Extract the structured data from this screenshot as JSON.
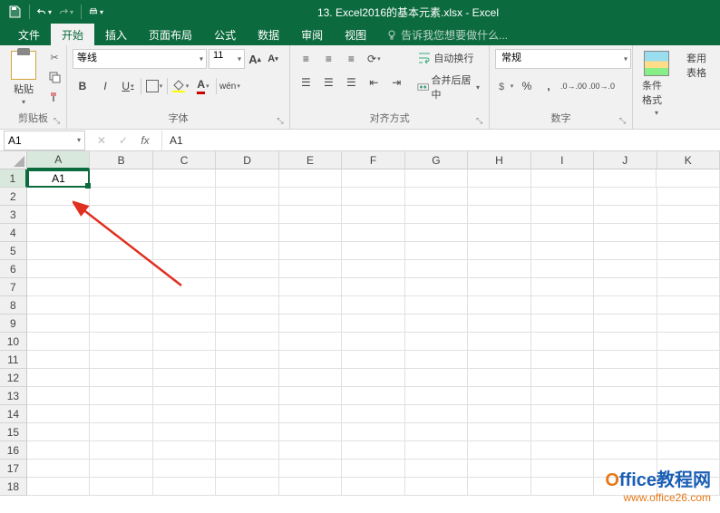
{
  "title": "13. Excel2016的基本元素.xlsx - Excel",
  "menus": [
    "文件",
    "开始",
    "插入",
    "页面布局",
    "公式",
    "数据",
    "审阅",
    "视图"
  ],
  "active_menu": 1,
  "tellme": "告诉我您想要做什么...",
  "ribbon": {
    "clipboard": {
      "label": "剪贴板",
      "paste": "粘贴"
    },
    "font": {
      "label": "字体",
      "name": "等线",
      "size": "11",
      "bold": "B",
      "italic": "I",
      "underline": "U",
      "wen": "wén"
    },
    "align": {
      "label": "对齐方式",
      "wrap": "自动换行",
      "merge": "合并后居中"
    },
    "number": {
      "label": "数字",
      "format": "常规"
    },
    "styles": {
      "cond": "条件格式",
      "table": "套用\n表格"
    }
  },
  "namebox": "A1",
  "formula": "A1",
  "columns": [
    "A",
    "B",
    "C",
    "D",
    "E",
    "F",
    "G",
    "H",
    "I",
    "J",
    "K"
  ],
  "rows": [
    1,
    2,
    3,
    4,
    5,
    6,
    7,
    8,
    9,
    10,
    11,
    12,
    13,
    14,
    15,
    16,
    17,
    18
  ],
  "active_cell": "A1",
  "cell_value": "A1",
  "watermark": {
    "brand_o": "O",
    "brand_text": "ffice教程网",
    "url": "www.office26.com"
  }
}
